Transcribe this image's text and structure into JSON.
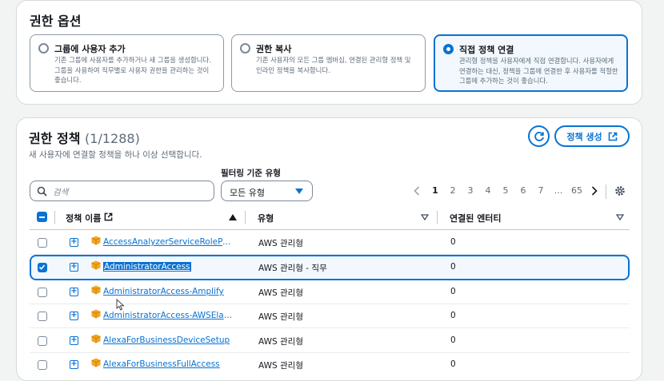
{
  "options": {
    "title": "권한 옵션",
    "cards": [
      {
        "title": "그룹에 사용자 추가",
        "desc": "기존 그룹에 사용자를 추가하거나 새 그룹을 생성합니다. 그룹을 사용하여 직무별로 사용자 권한을 관리하는 것이 좋습니다.",
        "selected": false
      },
      {
        "title": "권한 복사",
        "desc": "기존 사용자의 모든 그룹 멤버십, 연결된 관리형 정책 및 인라인 정책을 복사합니다.",
        "selected": false
      },
      {
        "title": "직접 정책 연결",
        "desc": "관리형 정책을 사용자에게 직접 연결합니다. 사용자에게 연결하는 대신, 정책을 그룹에 연결한 후 사용자를 적절한 그룹에 추가하는 것이 좋습니다.",
        "selected": true
      }
    ]
  },
  "policies": {
    "title": "권한 정책",
    "count": "(1/1288)",
    "subtitle": "새 사용자에 연결할 정책을 하나 이상 선택합니다.",
    "create_label": "정책 생성",
    "search_placeholder": "검색",
    "filter_label": "필터링 기준 유형",
    "filter_value": "모든 유형",
    "pages": [
      "1",
      "2",
      "3",
      "4",
      "5",
      "6",
      "7",
      "...",
      "65"
    ],
    "current_page": "1",
    "columns": {
      "name": "정책 이름",
      "type": "유형",
      "entities": "연결된 엔터티"
    },
    "rows": [
      {
        "name": "AccessAnalyzerServiceRolePol...",
        "type": "AWS 관리형",
        "entities": "0",
        "checked": false
      },
      {
        "name": "AdministratorAccess",
        "type": "AWS 관리형 - 직무",
        "entities": "0",
        "checked": true
      },
      {
        "name": "AdministratorAccess-Amplify",
        "type": "AWS 관리형",
        "entities": "0",
        "checked": false
      },
      {
        "name": "AdministratorAccess-AWSElas...",
        "type": "AWS 관리형",
        "entities": "0",
        "checked": false
      },
      {
        "name": "AlexaForBusinessDeviceSetup",
        "type": "AWS 관리형",
        "entities": "0",
        "checked": false
      },
      {
        "name": "AlexaForBusinessFullAccess",
        "type": "AWS 관리형",
        "entities": "0",
        "checked": false
      }
    ]
  },
  "colors": {
    "accent": "#0972d3",
    "package": "#f2a621"
  }
}
